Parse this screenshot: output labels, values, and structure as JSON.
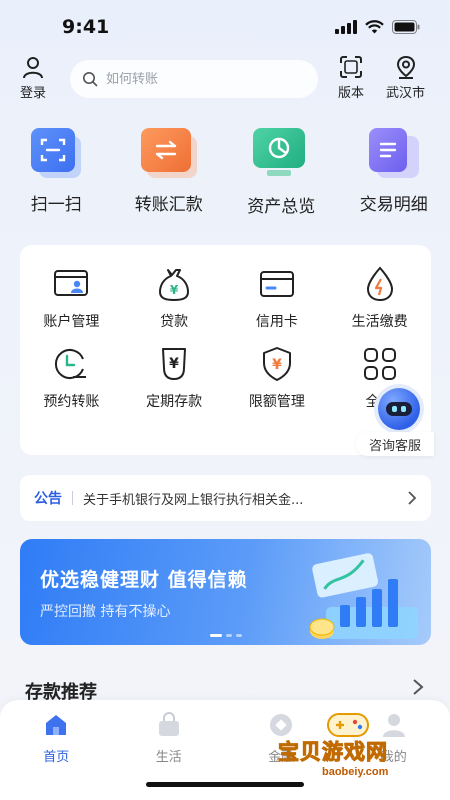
{
  "status_bar": {
    "time": "9:41"
  },
  "header": {
    "login_label": "登录",
    "search_placeholder": "如何转账",
    "version_label": "版本",
    "city_label": "武汉市"
  },
  "quick_actions": [
    {
      "label": "扫一扫",
      "icon": "scan-icon",
      "color": "#4a7cf3"
    },
    {
      "label": "转账汇款",
      "icon": "transfer-icon",
      "color": "#f07a3c"
    },
    {
      "label": "资产总览",
      "icon": "asset-chart-icon",
      "color": "#2bb58a"
    },
    {
      "label": "交易明细",
      "icon": "detail-list-icon",
      "color": "#7a6ef0"
    }
  ],
  "services": [
    {
      "label": "账户管理",
      "icon": "account-icon"
    },
    {
      "label": "贷款",
      "icon": "loan-bag-icon"
    },
    {
      "label": "信用卡",
      "icon": "credit-card-icon"
    },
    {
      "label": "生活缴费",
      "icon": "utility-icon"
    },
    {
      "label": "预约转账",
      "icon": "clock-icon"
    },
    {
      "label": "定期存款",
      "icon": "deposit-icon"
    },
    {
      "label": "限额管理",
      "icon": "shield-icon"
    },
    {
      "label": "全部",
      "icon": "all-grid-icon"
    }
  ],
  "assistant": {
    "label": "咨询客服"
  },
  "notice": {
    "tag": "公告",
    "text": "关于手机银行及网上银行执行相关金..."
  },
  "banner": {
    "title": "优选稳健理财  值得信赖",
    "subtitle": "严控回撤  持有不操心"
  },
  "deposit": {
    "title": "存款推荐"
  },
  "tabbar": [
    {
      "label": "首页",
      "icon": "home-icon",
      "active": true
    },
    {
      "label": "生活",
      "icon": "bag-icon",
      "active": false
    },
    {
      "label": "金融",
      "icon": "coin-icon",
      "active": false
    },
    {
      "label": "我的",
      "icon": "user-icon",
      "active": false
    }
  ],
  "watermark": {
    "main": "宝贝游戏网",
    "sub": "baobeiy.com"
  },
  "colors": {
    "accent": "#2b5fe0",
    "banner": "#2f7cf6"
  }
}
